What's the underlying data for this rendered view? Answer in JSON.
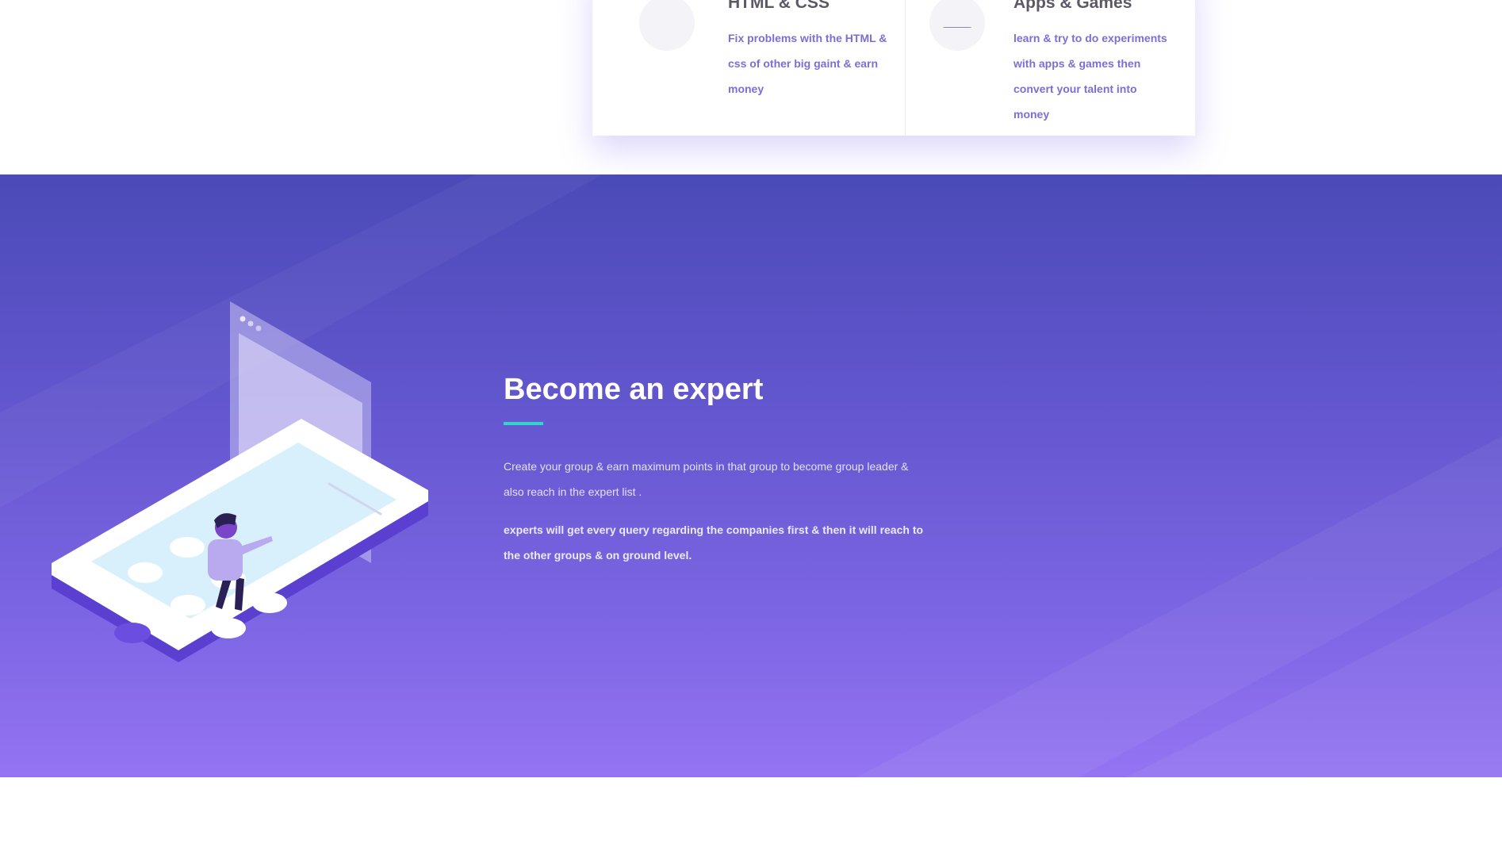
{
  "features": [
    {
      "icon": "html-css-icon",
      "title": "HTML & CSS",
      "description": "Fix problems with the HTML & css of other big gaint & earn money"
    },
    {
      "icon": "gamepad-icon",
      "title": "Apps & Games",
      "description": "learn & try to do experiments with apps & games then convert your talent into money"
    }
  ],
  "hero": {
    "title": "Become an expert",
    "text": "Create your group & earn maximum points in that group to become group leader & also reach in the expert list .",
    "text_strong": "experts will get every query regarding the companies first & then it will reach to the other groups & on ground level.",
    "illustration": "phone-user-illustration"
  },
  "colors": {
    "accent": "#2fd6c9",
    "hero_top": "#4b4ab8",
    "hero_bottom": "#9474f2",
    "feature_text": "#7b6ed6",
    "feature_title": "#5c5866"
  }
}
